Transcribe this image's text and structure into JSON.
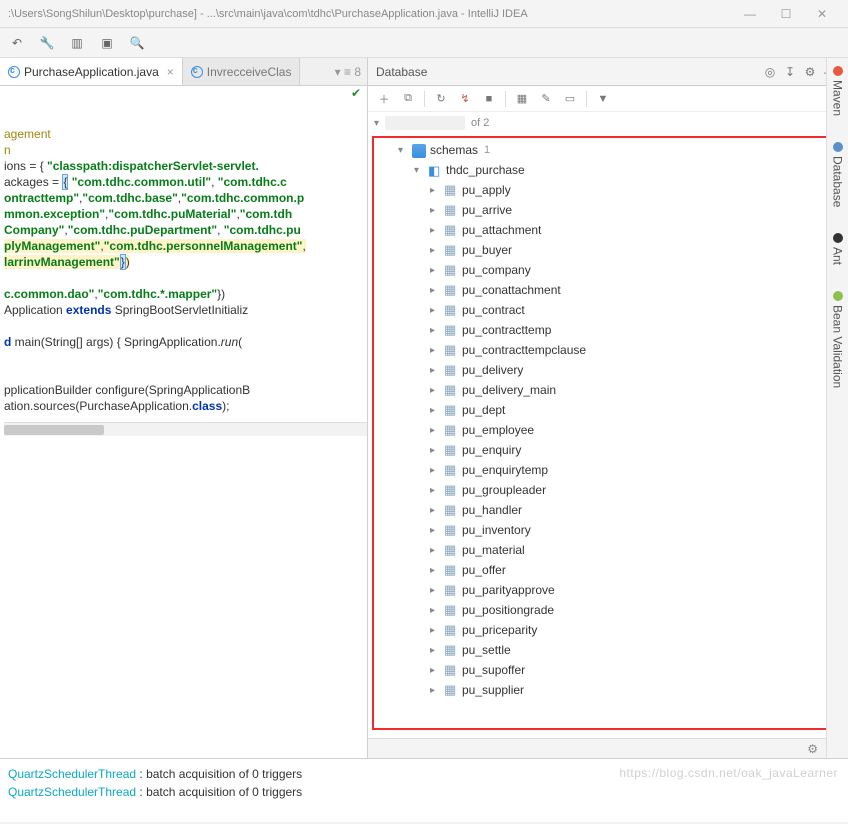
{
  "window": {
    "title": ":\\Users\\SongShilun\\Desktop\\purchase] - ...\\src\\main\\java\\com\\tdhc\\PurchaseApplication.java - IntelliJ IDEA"
  },
  "tabs": {
    "active": "PurchaseApplication.java",
    "inactive": "InvrecceiveClas",
    "trail": "▾ ≡ 8"
  },
  "db": {
    "panel_title": "Database",
    "of_label": "of 2",
    "schemas_label": "schemas",
    "schemas_count": "1",
    "database_name": "thdc_purchase",
    "tables": [
      "pu_apply",
      "pu_arrive",
      "pu_attachment",
      "pu_buyer",
      "pu_company",
      "pu_conattachment",
      "pu_contract",
      "pu_contracttemp",
      "pu_contracttempclause",
      "pu_delivery",
      "pu_delivery_main",
      "pu_dept",
      "pu_employee",
      "pu_enquiry",
      "pu_enquirytemp",
      "pu_groupleader",
      "pu_handler",
      "pu_inventory",
      "pu_material",
      "pu_offer",
      "pu_parityapprove",
      "pu_positiongrade",
      "pu_priceparity",
      "pu_settle",
      "pu_supoffer",
      "pu_supplier"
    ]
  },
  "sidebar": {
    "maven": "Maven",
    "database": "Database",
    "ant": "Ant",
    "bean": "Bean Validation"
  },
  "code": {
    "l1": "",
    "l2": "agement",
    "l3": "n",
    "l4a": "ions = { ",
    "l4b": "\"classpath:dispatcherServlet-servlet.",
    "l5a": "ackages = ",
    "l5br": "{",
    "l5b": " \"com.tdhc.common.util\"",
    "l5c": ", ",
    "l5d": "\"com.tdhc.c",
    "l6a": "ontracttemp\"",
    "l6b": ",",
    "l6c": "\"com.tdhc.base\"",
    "l6d": ",",
    "l6e": "\"com.tdhc.common.p",
    "l7a": "mmon.exception\"",
    "l7b": ",",
    "l7c": "\"com.tdhc.puMaterial\"",
    "l7d": ",",
    "l7e": "\"com.tdh",
    "l8a": "Company\"",
    "l8b": ",",
    "l8c": "\"com.tdhc.puDepartment\"",
    "l8d": ", ",
    "l8e": "\"com.tdhc.pu",
    "l9a": "plyManagement\"",
    "l9b": ",",
    "l9c": "\"com.tdhc.personnelManagement\"",
    "l9d": ",",
    "l10a": "larrinvManagement\"",
    "l10br": "}",
    "l10b": ")",
    "l11": "",
    "l12a": "c.common.dao\"",
    "l12b": ",",
    "l12c": "\"com.tdhc.*.mapper\"",
    "l12d": "})",
    "l13a": "Application ",
    "l13b": "extends",
    "l13c": " SpringBootServletInitializ",
    "l14": "",
    "l15a": "d",
    "l15b": " main(String[] args) { SpringApplication.",
    "l15c": "run",
    "l15d": "(",
    "l16": "",
    "l17": "",
    "l18": "pplicationBuilder configure(SpringApplicationB",
    "l19a": "ation.sources(PurchaseApplication.",
    "l19b": "class",
    "l19c": ");"
  },
  "console": {
    "l1a": "QuartzSchedulerThread",
    "l1b": "     : batch acquisition of 0 triggers",
    "l2a": "QuartzSchedulerThread",
    "l2b": "     : batch acquisition of 0 triggers"
  },
  "watermark": "https://blog.csdn.net/oak_javaLearner"
}
